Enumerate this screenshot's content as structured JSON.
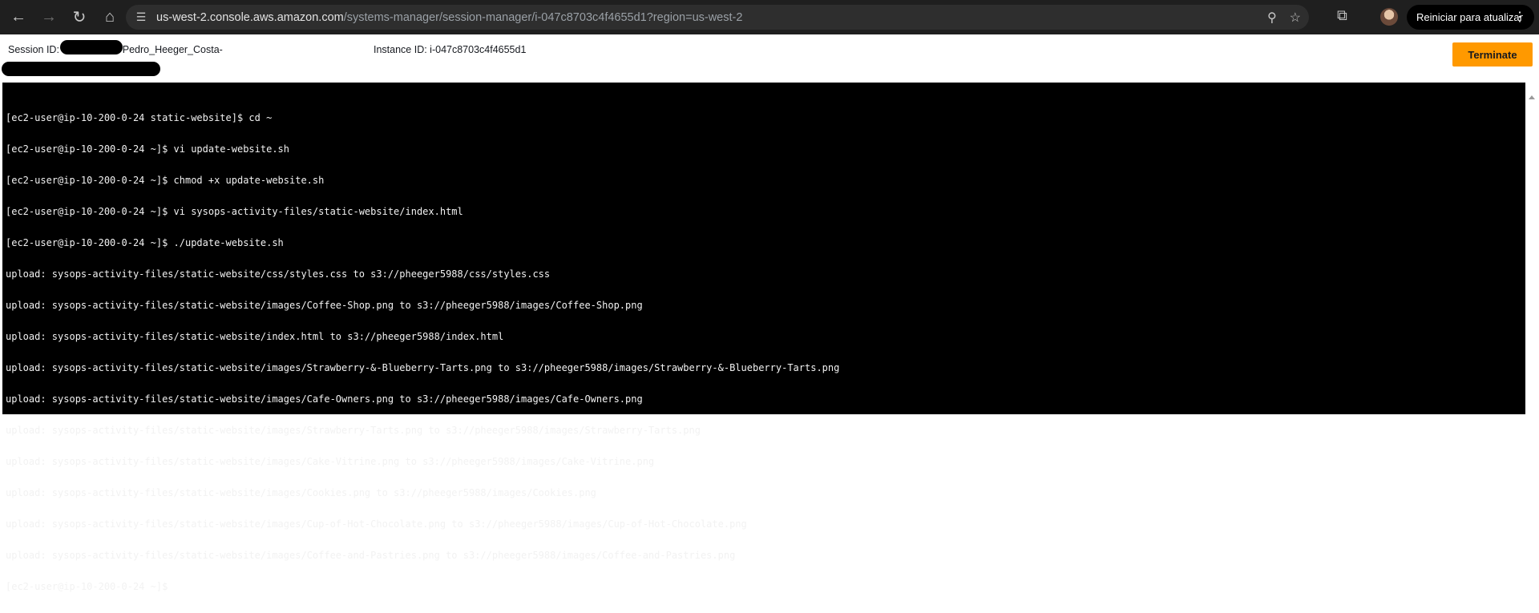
{
  "browser": {
    "url_host": "us-west-2.console.aws.amazon.com",
    "url_path": "/systems-manager/session-manager/i-047c8703c4f4655d1?region=us-west-2",
    "update_label": "Reiniciar para atualizar",
    "icons": [
      "back-icon",
      "forward-icon",
      "reload-icon",
      "home-icon",
      "site-info-icon",
      "zoom-icon",
      "bookmark-star-icon",
      "extensions-icon",
      "profile-avatar",
      "kebab-menu-icon"
    ]
  },
  "session": {
    "session_id_prefix": "Session ID: us",
    "session_id_suffix": "-Pedro_Heeger_Costa-",
    "instance_id": "Instance ID: i-047c8703c4f4655d1",
    "terminate_label": "Terminate",
    "accent": "#ff9900"
  },
  "terminal": {
    "lines": [
      "[ec2-user@ip-10-200-0-24 static-website]$ cd ~",
      "[ec2-user@ip-10-200-0-24 ~]$ vi update-website.sh",
      "[ec2-user@ip-10-200-0-24 ~]$ chmod +x update-website.sh",
      "[ec2-user@ip-10-200-0-24 ~]$ vi sysops-activity-files/static-website/index.html",
      "[ec2-user@ip-10-200-0-24 ~]$ ./update-website.sh",
      "upload: sysops-activity-files/static-website/css/styles.css to s3://pheeger5988/css/styles.css",
      "upload: sysops-activity-files/static-website/images/Coffee-Shop.png to s3://pheeger5988/images/Coffee-Shop.png",
      "upload: sysops-activity-files/static-website/index.html to s3://pheeger5988/index.html",
      "upload: sysops-activity-files/static-website/images/Strawberry-&-Blueberry-Tarts.png to s3://pheeger5988/images/Strawberry-&-Blueberry-Tarts.png",
      "upload: sysops-activity-files/static-website/images/Cafe-Owners.png to s3://pheeger5988/images/Cafe-Owners.png",
      "upload: sysops-activity-files/static-website/images/Strawberry-Tarts.png to s3://pheeger5988/images/Strawberry-Tarts.png",
      "upload: sysops-activity-files/static-website/images/Cake-Vitrine.png to s3://pheeger5988/images/Cake-Vitrine.png",
      "upload: sysops-activity-files/static-website/images/Cookies.png to s3://pheeger5988/images/Cookies.png",
      "upload: sysops-activity-files/static-website/images/Cup-of-Hot-Chocolate.png to s3://pheeger5988/images/Cup-of-Hot-Chocolate.png",
      "upload: sysops-activity-files/static-website/images/Coffee-and-Pastries.png to s3://pheeger5988/images/Coffee-and-Pastries.png"
    ],
    "prompt": "[ec2-user@ip-10-200-0-24 ~]$"
  }
}
